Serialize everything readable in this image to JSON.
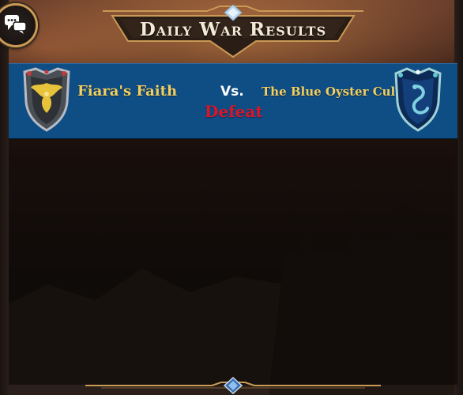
{
  "header": {
    "title": "Daily War Results"
  },
  "chat_button": {
    "icon": "chat-bubbles-icon"
  },
  "war": {
    "home_guild": "Fiara's Faith",
    "versus_label": "Vs.",
    "away_guild": "The Blue Oyster Cult",
    "outcome": "Defeat"
  },
  "crests": {
    "home": {
      "icon": "golden-phoenix-crest-icon"
    },
    "away": {
      "icon": "blue-serpent-crest-icon"
    }
  },
  "colors": {
    "banner_blue": "#0f4d85",
    "guild_name_gold": "#f3cf5e",
    "defeat_red": "#d8162a",
    "frame_gold": "#c99a55",
    "title_cream": "#f3ead5"
  }
}
